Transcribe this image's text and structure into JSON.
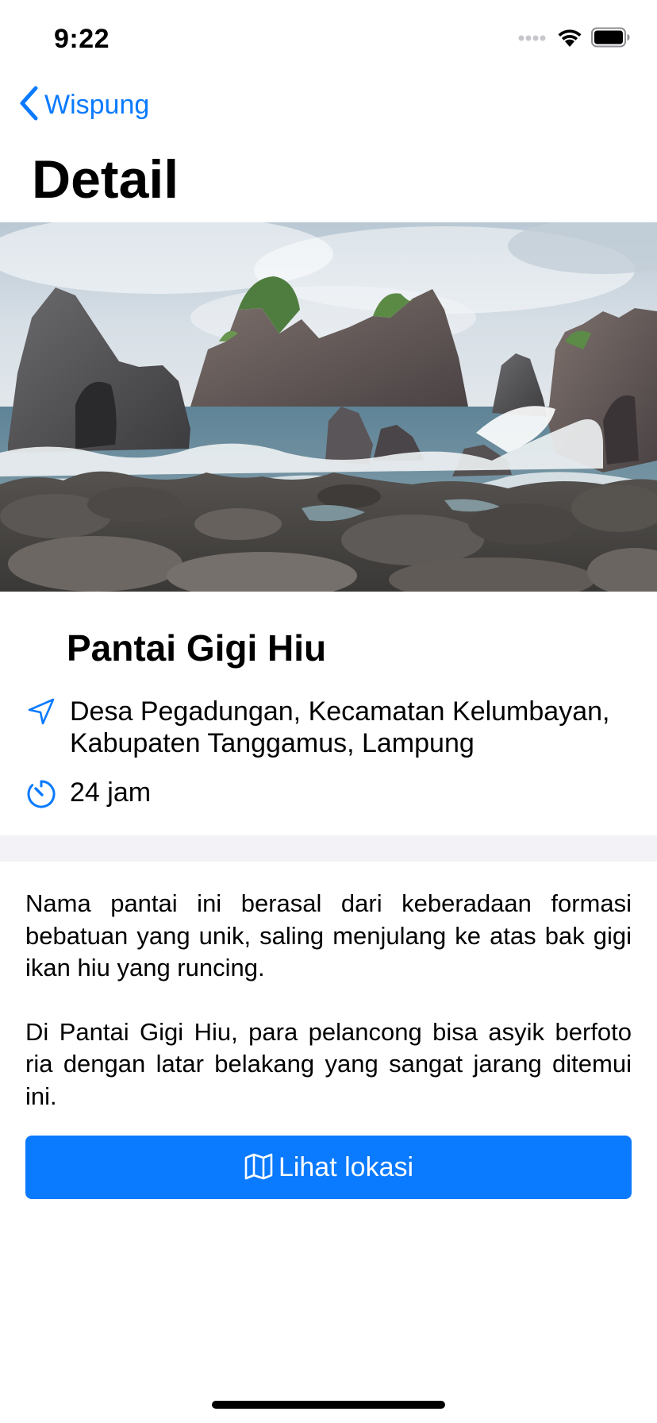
{
  "status_bar": {
    "time": "9:22",
    "signal_icon": "cellular-signal-icon",
    "wifi_icon": "wifi-icon",
    "battery_icon": "battery-icon"
  },
  "nav": {
    "back_label": "Wispung",
    "back_icon": "chevron-left-icon",
    "title": "Detail"
  },
  "hero_image": {
    "subject": "rocky beach photo",
    "icon": "photo"
  },
  "place": {
    "name": "Pantai Gigi Hiu",
    "address": "Desa Pegadungan, Kecamatan Kelumbayan, Kabupaten Tanggamus, Lampung",
    "address_icon": "location-arrow-icon",
    "hours": "24 jam",
    "hours_icon": "timer-icon"
  },
  "description": {
    "paragraph_1": "Nama pantai ini berasal dari keberadaan formasi bebatuan yang unik, saling menjulang ke atas bak gigi ikan hiu yang runcing.",
    "paragraph_2": "Di Pantai Gigi Hiu, para pelancong bisa asyik berfoto ria dengan latar belakang yang sangat jarang ditemui ini."
  },
  "action_button": {
    "label": "Lihat lokasi",
    "icon": "map-icon"
  },
  "colors": {
    "accent": "#0a7aff",
    "separator": "#f2f2f7",
    "text": "#000000",
    "background": "#ffffff"
  }
}
